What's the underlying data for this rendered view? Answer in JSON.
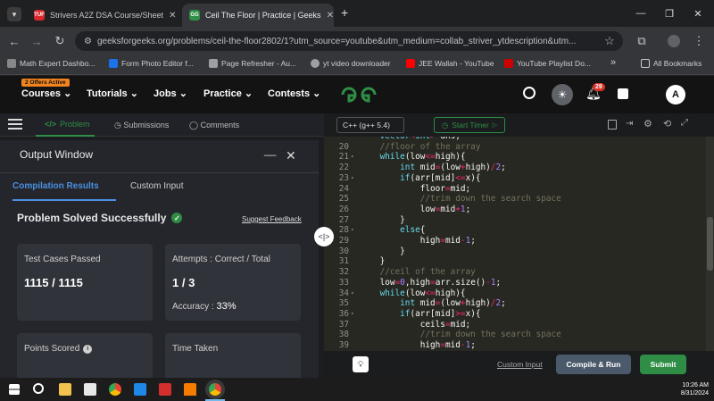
{
  "browser": {
    "tabs": [
      {
        "title": "Strivers A2Z DSA Course/Sheet",
        "favicon_text": "TUF",
        "active": false
      },
      {
        "title": "Ceil The Floor | Practice | Geeks",
        "favicon_text": "GG",
        "active": true
      }
    ],
    "new_tab_symbol": "+",
    "url": "geeksforgeeks.org/problems/ceil-the-floor2802/1?utm_source=youtube&utm_medium=collab_striver_ytdescription&utm...",
    "bookmarks": [
      "Math Expert Dashbo...",
      "Form Photo Editor f...",
      "Page Refresher - Au...",
      "yt video downloader",
      "JEE Wallah - YouTube",
      "YouTube Playlist Do..."
    ],
    "bookmarks_more": "»",
    "all_bookmarks": "All Bookmarks"
  },
  "site": {
    "offers_badge": "2 Offers Active",
    "nav": [
      "Courses",
      "Tutorials",
      "Jobs",
      "Practice",
      "Contests"
    ],
    "logo_text": "GfG",
    "notification_count": "29",
    "avatar_letter": "A"
  },
  "left_panel": {
    "tabs": [
      "Problem",
      "Submissions",
      "Comments"
    ],
    "output_window_title": "Output Window",
    "result_tabs": [
      "Compilation Results",
      "Custom Input"
    ],
    "status": "Problem Solved Successfully",
    "suggest_feedback": "Suggest Feedback",
    "test_cases_label": "Test Cases Passed",
    "test_cases_value": "1115 / 1115",
    "attempts_label": "Attempts : Correct / Total",
    "attempts_value": "1 / 3",
    "accuracy_label": "Accuracy :",
    "accuracy_value": "33%",
    "points_label": "Points Scored",
    "time_label": "Time Taken"
  },
  "editor": {
    "language": "C++ (g++ 5.4)",
    "timer_label": "Start Timer",
    "footer": {
      "custom_input": "Custom Input",
      "compile_run": "Compile & Run",
      "submit": "Submit"
    },
    "lines": [
      {
        "n": "",
        "text": "    vector<int> ans;",
        "fold": false
      },
      {
        "n": "20",
        "text": "    //floor of the array",
        "fold": false
      },
      {
        "n": "21",
        "text": "    while(low<=high){",
        "fold": true
      },
      {
        "n": "22",
        "text": "        int mid=(low+high)/2;",
        "fold": false
      },
      {
        "n": "23",
        "text": "        if(arr[mid]<=x){",
        "fold": true
      },
      {
        "n": "24",
        "text": "            floor=mid;",
        "fold": false
      },
      {
        "n": "25",
        "text": "            //trim down the search space",
        "fold": false
      },
      {
        "n": "26",
        "text": "            low=mid+1;",
        "fold": false
      },
      {
        "n": "27",
        "text": "        }",
        "fold": false
      },
      {
        "n": "28",
        "text": "        else{",
        "fold": true
      },
      {
        "n": "29",
        "text": "            high=mid-1;",
        "fold": false
      },
      {
        "n": "30",
        "text": "        }",
        "fold": false
      },
      {
        "n": "31",
        "text": "    }",
        "fold": false
      },
      {
        "n": "32",
        "text": "    //ceil of the array",
        "fold": false
      },
      {
        "n": "33",
        "text": "    low=0,high=arr.size()-1;",
        "fold": false
      },
      {
        "n": "34",
        "text": "    while(low<=high){",
        "fold": true
      },
      {
        "n": "35",
        "text": "        int mid=(low+high)/2;",
        "fold": false
      },
      {
        "n": "36",
        "text": "        if(arr[mid]>=x){",
        "fold": true
      },
      {
        "n": "37",
        "text": "            ceils=mid;",
        "fold": false
      },
      {
        "n": "38",
        "text": "            //trim down the search space",
        "fold": false
      },
      {
        "n": "39",
        "text": "            high=mid-1;",
        "fold": false
      }
    ]
  },
  "taskbar": {
    "time": "10:26 AM",
    "date": "8/31/2024"
  },
  "colors": {
    "gfg_green": "#2f8d46",
    "editor_bg": "#272822",
    "keyword": "#66d9ef",
    "comment": "#75715e",
    "number": "#ae81ff",
    "operator": "#f92672",
    "submit": "#2f8d46",
    "compile": "#4b5a6a"
  }
}
